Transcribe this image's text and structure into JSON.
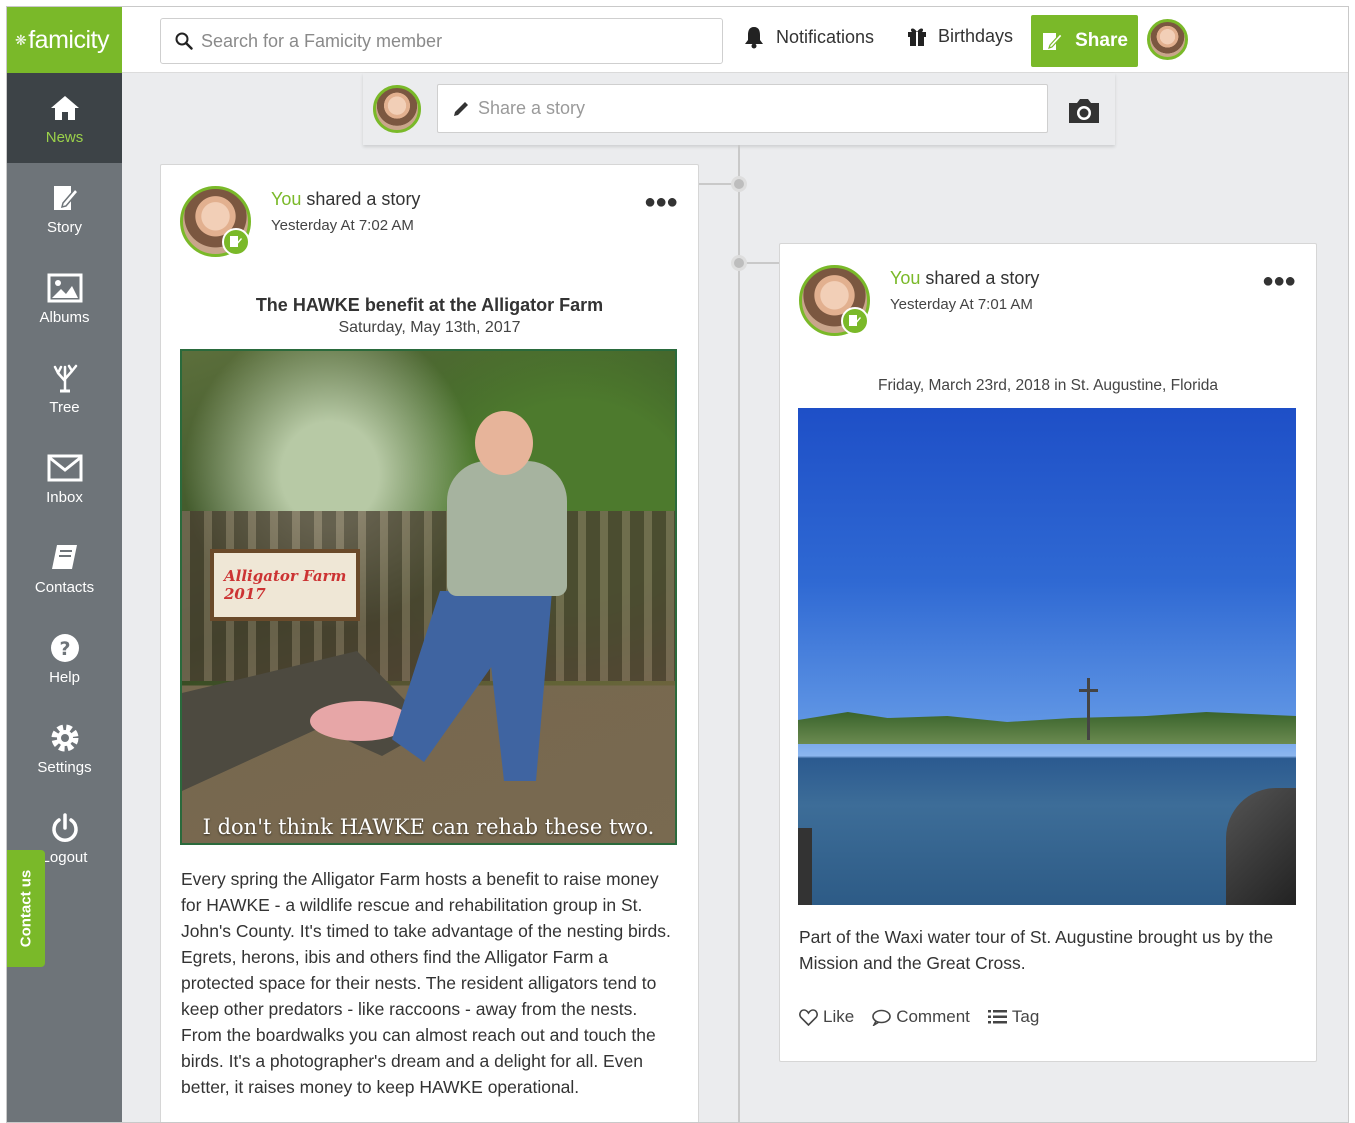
{
  "brand": {
    "name": "famicity",
    "accent": "#7ab929"
  },
  "search": {
    "placeholder": "Search for a Famicity member"
  },
  "header": {
    "notifications": "Notifications",
    "birthdays": "Birthdays",
    "share": "Share"
  },
  "sidebar": {
    "items": [
      {
        "label": "News",
        "icon": "home-icon",
        "active": true
      },
      {
        "label": "Story",
        "icon": "story-icon"
      },
      {
        "label": "Albums",
        "icon": "image-icon"
      },
      {
        "label": "Tree",
        "icon": "tree-icon"
      },
      {
        "label": "Inbox",
        "icon": "envelope-icon"
      },
      {
        "label": "Contacts",
        "icon": "book-icon"
      },
      {
        "label": "Help",
        "icon": "question-icon"
      },
      {
        "label": "Settings",
        "icon": "gear-icon"
      },
      {
        "label": "Logout",
        "icon": "power-icon"
      }
    ],
    "contact_tab": "Contact us"
  },
  "composer": {
    "placeholder": "Share a story"
  },
  "posts": [
    {
      "author_you": "You",
      "author_rest": " shared a story",
      "time": "Yesterday At 7:02 AM",
      "title": "The HAWKE benefit at the Alligator Farm",
      "date": "Saturday, May 13th, 2017",
      "photo_caption": "I don't think HAWKE can rehab these two.",
      "sign_text": "Alligator Farm 2017",
      "body": "Every spring the Alligator Farm hosts a benefit to raise money for HAWKE - a wildlife rescue and rehabilitation group in St. John's County. It's timed to take advantage of the nesting birds. Egrets, herons, ibis and others find the Alligator Farm a protected space for their nests. The resident alligators tend to keep other predators - like raccoons - away from the nests. From the boardwalks you can almost reach out and touch the birds. It's a photographer's dream and a delight for all. Even better, it raises money to keep HAWKE operational."
    },
    {
      "author_you": "You",
      "author_rest": " shared a story",
      "time": "Yesterday At 7:01 AM",
      "date_location": "Friday, March 23rd, 2018 in St. Augustine, Florida",
      "body": "Part of the Waxi water tour of St. Augustine brought us by the Mission and the Great Cross.",
      "actions": {
        "like": "Like",
        "comment": "Comment",
        "tag": "Tag"
      }
    }
  ]
}
